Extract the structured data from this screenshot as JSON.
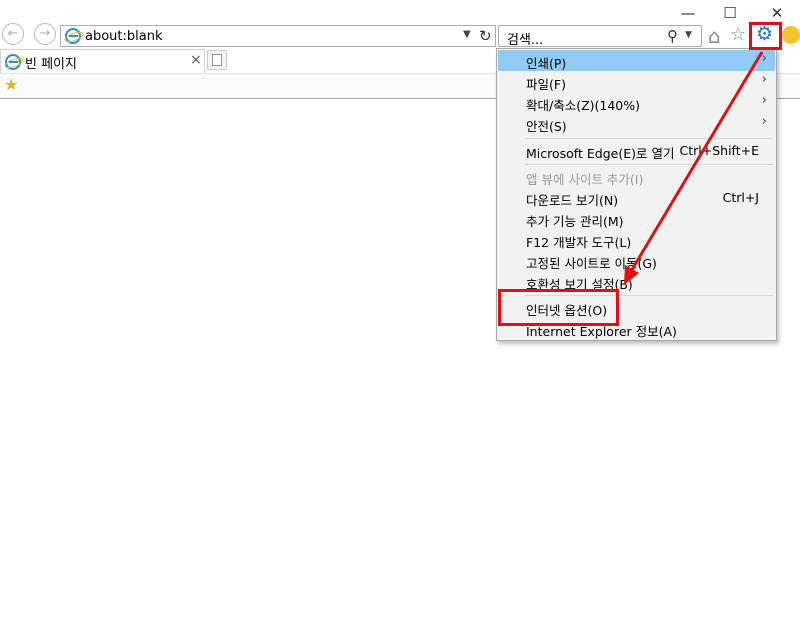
{
  "window": {
    "controls": {
      "minimize": "—",
      "maximize": "☐",
      "close": "✕"
    }
  },
  "nav": {
    "back_icon": "back-arrow-icon",
    "forward_icon": "forward-arrow-icon"
  },
  "address_bar": {
    "value": "about:blank",
    "refresh_icon": "refresh-icon",
    "dropdown_icon": "chevron-down-icon"
  },
  "search_box": {
    "placeholder": "검색...",
    "search_icon": "search-icon"
  },
  "tab": {
    "title": "빈 페이지",
    "close": "×"
  },
  "toolbar_icons": [
    "home-icon",
    "favorites-star-icon",
    "gear-icon",
    "smiley-icon"
  ],
  "menu": {
    "items": [
      {
        "label": "인쇄(P)",
        "shortcut": "",
        "submenu": true,
        "highlighted": true,
        "disabled": false
      },
      {
        "label": "파일(F)",
        "shortcut": "",
        "submenu": true,
        "highlighted": false,
        "disabled": false
      },
      {
        "label": "확대/축소(Z)(140%)",
        "shortcut": "",
        "submenu": true,
        "highlighted": false,
        "disabled": false
      },
      {
        "label": "안전(S)",
        "shortcut": "",
        "submenu": true,
        "highlighted": false,
        "disabled": false
      },
      {
        "label": "Microsoft Edge(E)로 열기",
        "shortcut": "Ctrl+Shift+E",
        "submenu": false,
        "highlighted": false,
        "disabled": false
      },
      {
        "label": "앱 뷰에 사이트 추가(I)",
        "shortcut": "",
        "submenu": false,
        "highlighted": false,
        "disabled": true
      },
      {
        "label": "다운로드 보기(N)",
        "shortcut": "Ctrl+J",
        "submenu": false,
        "highlighted": false,
        "disabled": false
      },
      {
        "label": "추가 기능 관리(M)",
        "shortcut": "",
        "submenu": false,
        "highlighted": false,
        "disabled": false
      },
      {
        "label": "F12 개발자 도구(L)",
        "shortcut": "",
        "submenu": false,
        "highlighted": false,
        "disabled": false
      },
      {
        "label": "고정된 사이트로 이동(G)",
        "shortcut": "",
        "submenu": false,
        "highlighted": false,
        "disabled": false
      },
      {
        "label": "호환성 보기 설정(B)",
        "shortcut": "",
        "submenu": false,
        "highlighted": false,
        "disabled": false
      },
      {
        "label": "인터넷 옵션(O)",
        "shortcut": "",
        "submenu": false,
        "highlighted": false,
        "disabled": false
      },
      {
        "label": "Internet Explorer 정보(A)",
        "shortcut": "",
        "submenu": false,
        "highlighted": false,
        "disabled": false
      }
    ]
  },
  "colors": {
    "highlight": "#91c9f7",
    "annotation_red": "#e01010",
    "gear_blue": "#1e74c9"
  }
}
